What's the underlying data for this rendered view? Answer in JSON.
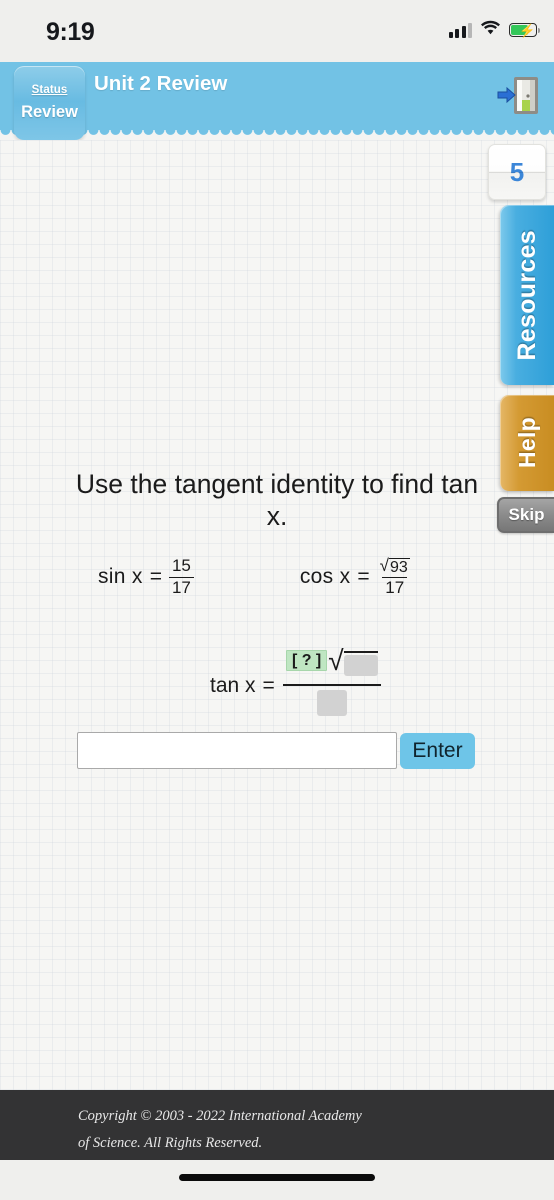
{
  "status_bar": {
    "time": "9:19",
    "signal_icon": "cellular-signal-icon",
    "wifi_icon": "wifi-icon",
    "battery_icon": "battery-charging-icon"
  },
  "header": {
    "title": "Unit 2 Review",
    "status_label": "Status",
    "status_value": "Review",
    "exit_icon": "exit-door-icon",
    "background_color": "#72c2e5"
  },
  "sidebar": {
    "counter_value": "5",
    "tabs": [
      {
        "label": "Resources",
        "color": "#2e9fd8"
      },
      {
        "label": "Help",
        "color": "#d49a33"
      }
    ],
    "skip_label": "Skip"
  },
  "question": {
    "prompt": "Use the tangent identity to find tan x.",
    "given": [
      {
        "function": "sin x",
        "equals": "=",
        "numerator": "15",
        "denominator": "17",
        "radicand": null
      },
      {
        "function": "cos x",
        "equals": "=",
        "radical_sign": "√",
        "radicand": "93",
        "denominator": "17"
      }
    ],
    "answer_expression": {
      "function": "tan x",
      "equals": "=",
      "numerator_placeholder": "[ ? ]",
      "radical_sign": "√",
      "radicand_placeholder": "",
      "denominator_placeholder": ""
    }
  },
  "answer_area": {
    "input_value": "",
    "input_placeholder": "",
    "submit_label": "Enter",
    "submit_color": "#6ec5e8"
  },
  "footer": {
    "line1": "Copyright © 2003 - 2022 International Academy",
    "line2": "of Science.  All Rights Reserved."
  }
}
